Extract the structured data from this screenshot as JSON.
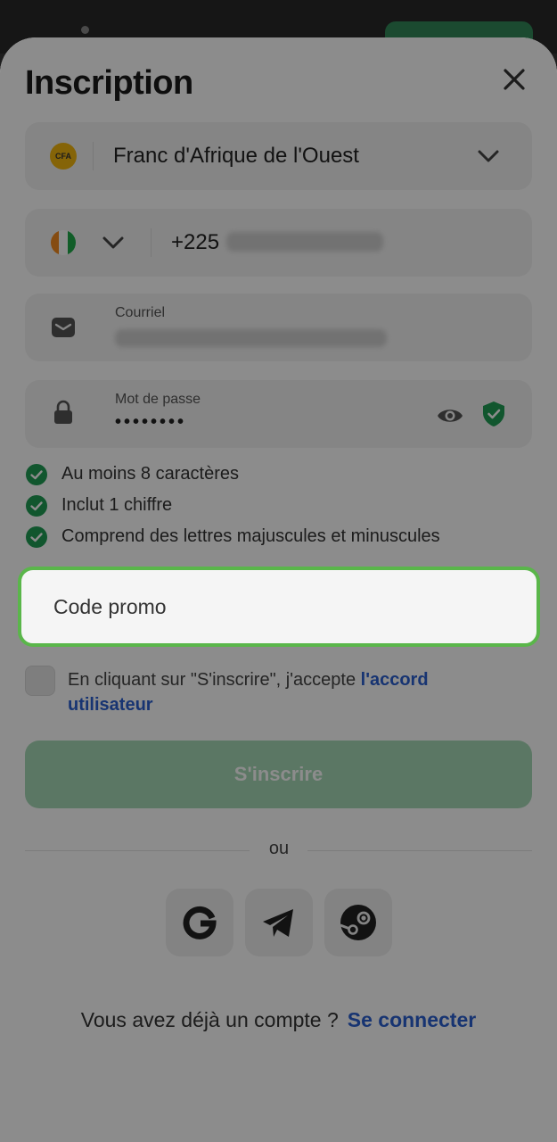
{
  "title": "Inscription",
  "currency": {
    "badge": "CFA",
    "label": "Franc d'Afrique de l'Ouest"
  },
  "phone": {
    "code": "+225"
  },
  "email": {
    "label": "Courriel"
  },
  "password": {
    "label": "Mot de passe",
    "value": "••••••••"
  },
  "rules": [
    {
      "text": "Au moins 8 caractères"
    },
    {
      "text": "Inclut 1 chiffre"
    },
    {
      "text": "Comprend des lettres majuscules et minuscules"
    }
  ],
  "promo": {
    "placeholder": "Code promo"
  },
  "accept": {
    "text": "En cliquant sur \"S'inscrire\", j'accepte ",
    "link": "l'accord utilisateur"
  },
  "submit_label": "S'inscrire",
  "or_label": "ou",
  "signin": {
    "question": "Vous avez déjà un compte ?",
    "link": "Se connecter"
  },
  "colors": {
    "accent_green": "#5ab64a",
    "link_blue": "#2a5fcf",
    "check_green": "#1f9d55"
  },
  "icons": [
    "close-icon",
    "chevron-down-icon",
    "mail-icon",
    "lock-icon",
    "eye-icon",
    "shield-check-icon",
    "check-circle-icon",
    "google-icon",
    "telegram-icon",
    "steam-icon"
  ]
}
